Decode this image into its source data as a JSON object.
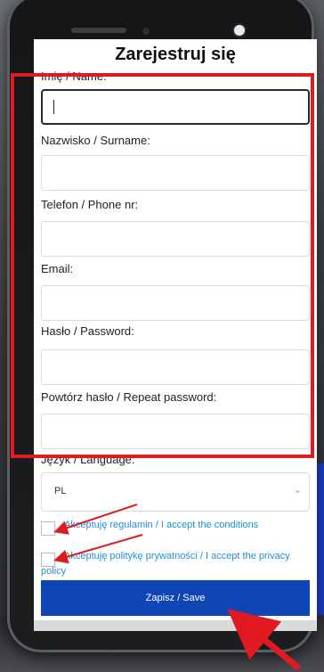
{
  "screen": {
    "title": "Zarejestruj się",
    "fields": [
      {
        "label": "Imię / Name:",
        "value": "",
        "placeholder": ""
      },
      {
        "label": "Nazwisko / Surname:",
        "value": "",
        "placeholder": ""
      },
      {
        "label": "Telefon / Phone nr:",
        "value": "",
        "placeholder": ""
      },
      {
        "label": "Email:",
        "value": "",
        "placeholder": ""
      },
      {
        "label": "Hasło / Password:",
        "value": "",
        "placeholder": ""
      },
      {
        "label": "Powtórz hasło / Repeat password:",
        "value": "",
        "placeholder": ""
      }
    ],
    "language": {
      "label": "Język / Language:",
      "selected": "PL"
    },
    "checkboxes": [
      {
        "label": "Akceptuję regulamin / I accept the conditions",
        "checked": false
      },
      {
        "label": "Akceptuję politykę prywatności / I accept the privacy policy",
        "checked": false
      }
    ],
    "save_label": "Zapisz / Save"
  },
  "colors": {
    "annotation_red": "#e01a21",
    "button_blue": "#1045b5",
    "link_blue": "#1f8fd6"
  },
  "icons": {
    "select": "chevron-down-icon"
  }
}
